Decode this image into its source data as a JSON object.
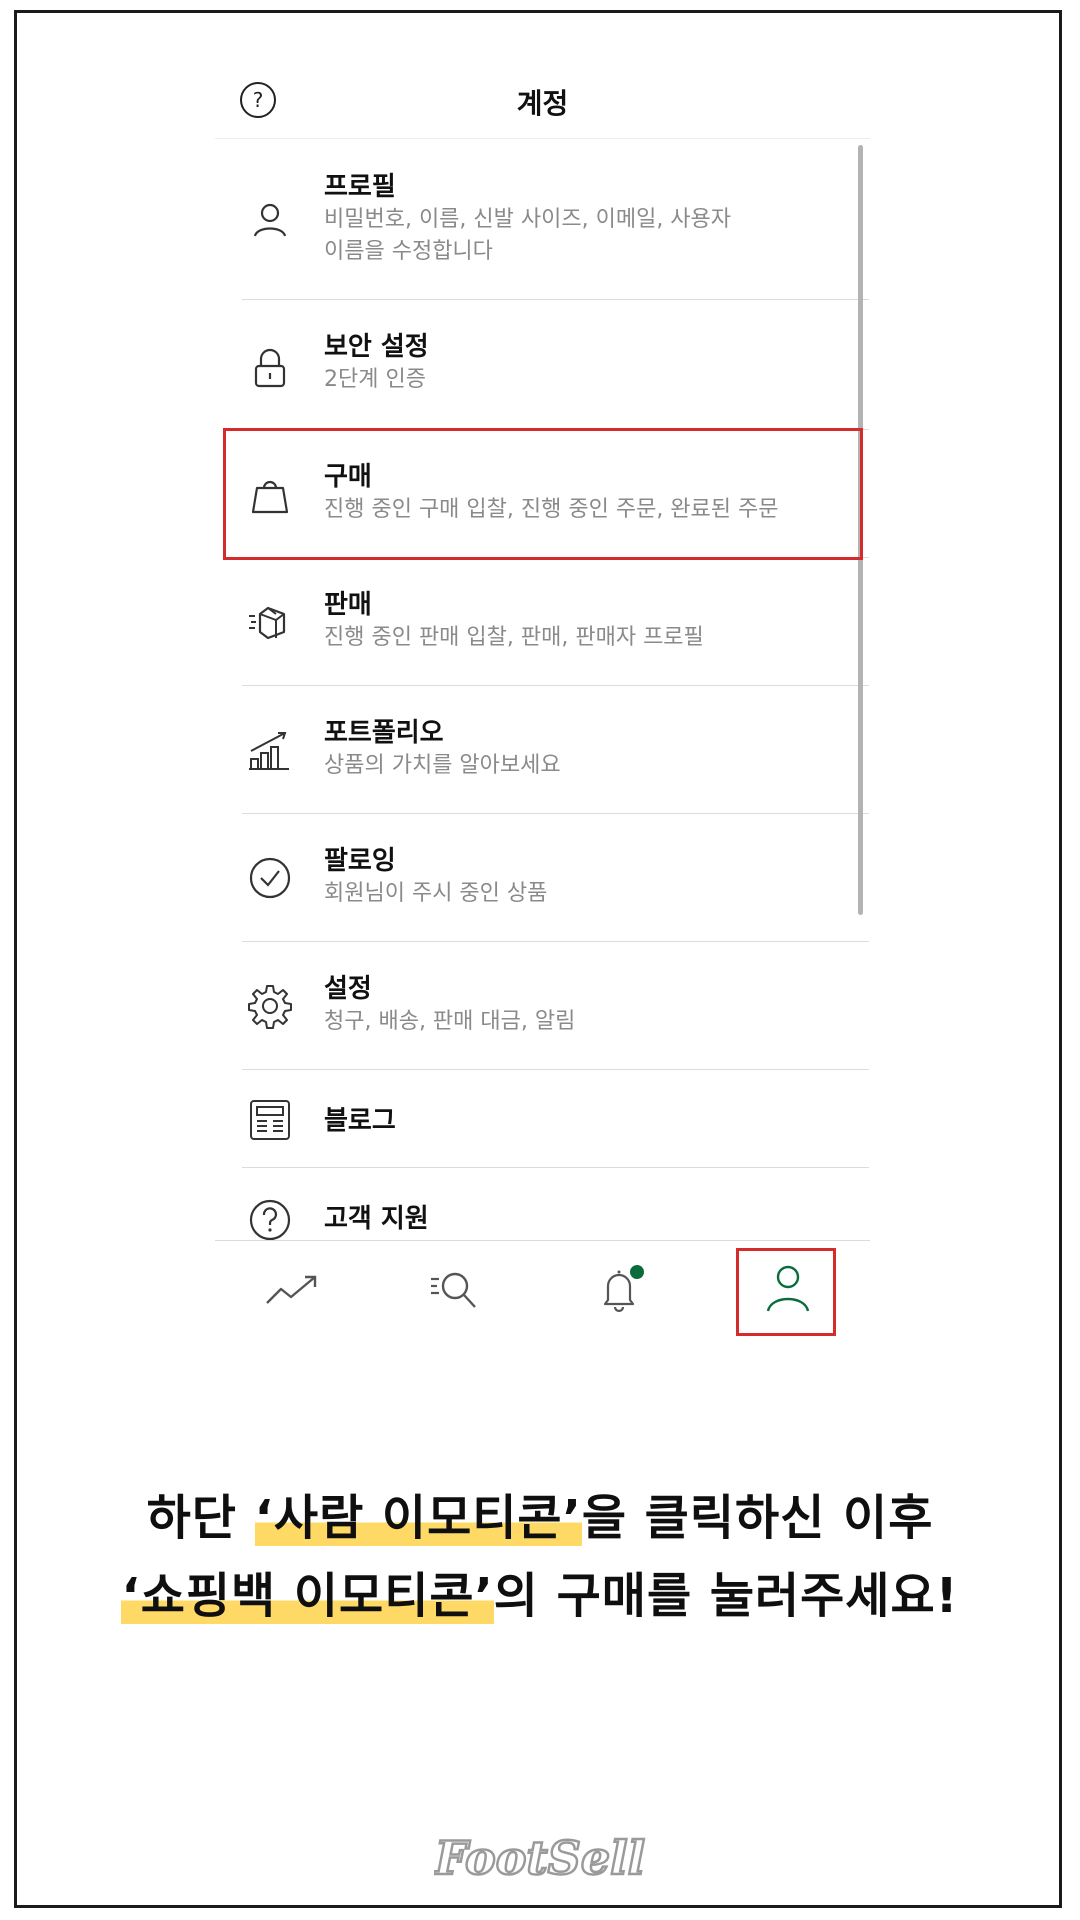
{
  "header": {
    "help_glyph": "?",
    "title": "계정"
  },
  "menu": {
    "items": [
      {
        "icon": "person-icon",
        "title": "프로필",
        "desc": "비밀번호, 이름, 신발 사이즈, 이메일, 사용자 이름을 수정합니다"
      },
      {
        "icon": "lock-icon",
        "title": "보안 설정",
        "desc": "2단계 인증"
      },
      {
        "icon": "shopping-bag-icon",
        "title": "구매",
        "desc": "진행 중인 구매 입찰, 진행 중인 주문, 완료된 주문"
      },
      {
        "icon": "box-icon",
        "title": "판매",
        "desc": "진행 중인 판매 입찰, 판매, 판매자 프로필"
      },
      {
        "icon": "portfolio-chart-icon",
        "title": "포트폴리오",
        "desc": "상품의 가치를 알아보세요"
      },
      {
        "icon": "check-circle-icon",
        "title": "팔로잉",
        "desc": "회원님이 주시 중인 상품"
      },
      {
        "icon": "gear-icon",
        "title": "설정",
        "desc": "청구, 배송, 판매 대금, 알림"
      },
      {
        "icon": "blog-icon",
        "title": "블로그",
        "desc": ""
      },
      {
        "icon": "help-circle-icon",
        "title": "고객 지원",
        "desc": ""
      }
    ]
  },
  "tabbar": {
    "tabs": [
      {
        "icon": "trending-icon"
      },
      {
        "icon": "search-list-icon"
      },
      {
        "icon": "bell-icon",
        "badge_color": "#0b6b3a"
      },
      {
        "icon": "person-icon",
        "active": true,
        "color": "#0b6b3a"
      }
    ]
  },
  "caption": {
    "line1_pre": "하단 ",
    "line1_mark": "‘사람 이모티콘’",
    "line1_post": "을 클릭하신 이후",
    "line2_mark": "‘쇼핑백 이모티콘’",
    "line2_post": "의 구매를 눌러주세요!"
  },
  "logo": {
    "text": "FootSell"
  },
  "colors": {
    "highlight_border": "#d42b2b",
    "marker_yellow": "#ffd966",
    "active_green": "#0b6b3a"
  }
}
